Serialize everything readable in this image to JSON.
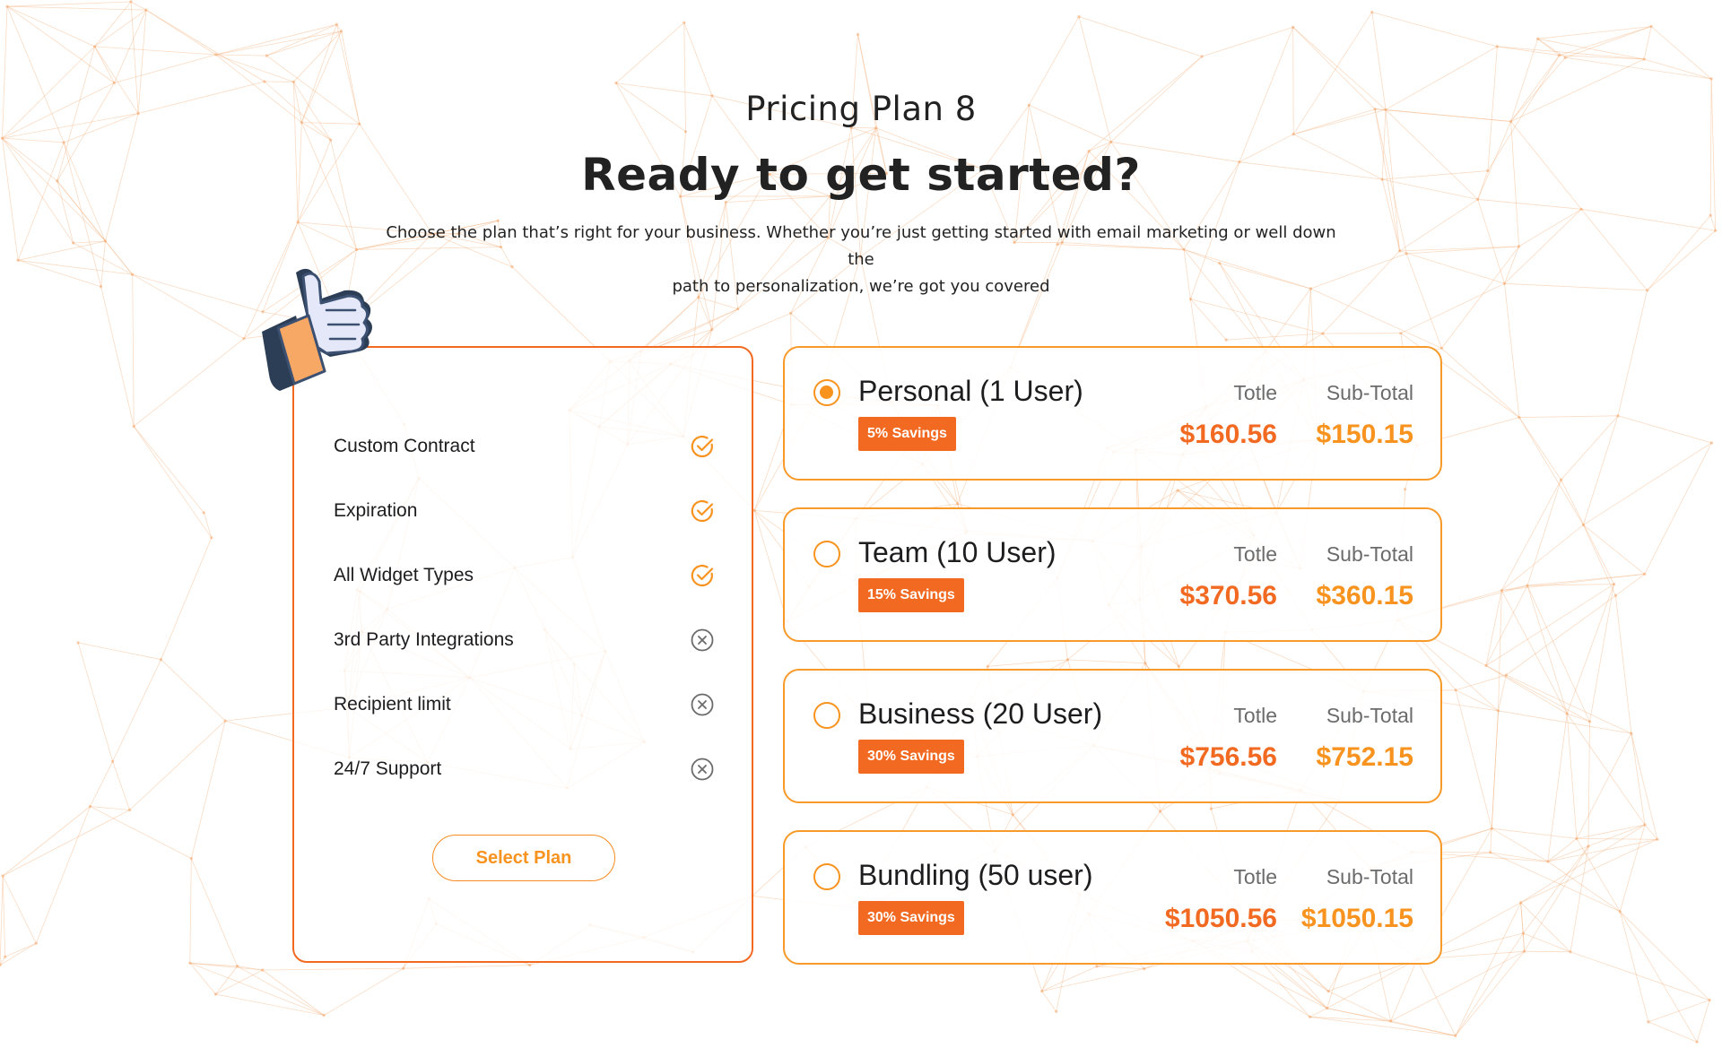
{
  "header": {
    "eyebrow": "Pricing Plan 8",
    "title": "Ready to get started?",
    "lede_line1": "Choose the plan that’s right for your business. Whether you’re just getting started with email marketing or well down the",
    "lede_line2": "path to personalization, we’re got you covered"
  },
  "features": {
    "items": [
      {
        "label": "Custom Contract",
        "included": true
      },
      {
        "label": "Expiration",
        "included": true
      },
      {
        "label": "All Widget Types",
        "included": true
      },
      {
        "label": "3rd Party Integrations",
        "included": false
      },
      {
        "label": "Recipient limit",
        "included": false
      },
      {
        "label": "24/7 Support",
        "included": false
      }
    ],
    "select_label": "Select Plan"
  },
  "plans": [
    {
      "name": "Personal (1 User)",
      "savings": "5% Savings",
      "totle_label": "Totle",
      "sub_label": "Sub-Total",
      "totle": "$160.56",
      "sub_total": "$150.15",
      "selected": true
    },
    {
      "name": "Team (10 User)",
      "savings": "15% Savings",
      "totle_label": "Totle",
      "sub_label": "Sub-Total",
      "totle": "$370.56",
      "sub_total": "$360.15",
      "selected": false
    },
    {
      "name": "Business (20 User)",
      "savings": "30% Savings",
      "totle_label": "Totle",
      "sub_label": "Sub-Total",
      "totle": "$756.56",
      "sub_total": "$752.15",
      "selected": false
    },
    {
      "name": "Bundling (50 user)",
      "savings": "30% Savings",
      "totle_label": "Totle",
      "sub_label": "Sub-Total",
      "totle": "$1050.56",
      "sub_total": "$1050.15",
      "selected": false
    }
  ],
  "colors": {
    "accent": "#f26a21",
    "accent_light": "#f7931e",
    "muted_icon": "#6b6b6b"
  },
  "icons": {
    "included": "check-circle-icon",
    "excluded": "x-circle-icon",
    "decoration": "thumbs-up-icon"
  }
}
